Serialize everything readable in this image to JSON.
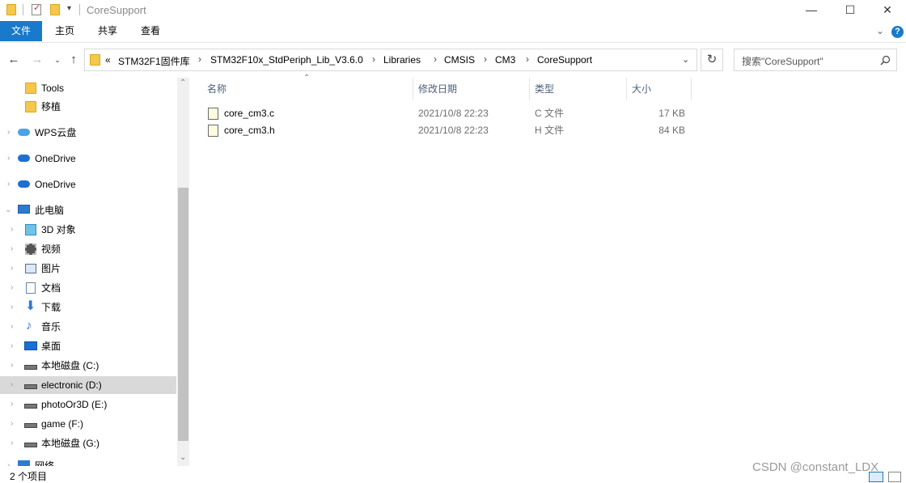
{
  "window": {
    "title": "CoreSupport",
    "minimize": "—",
    "maximize": "☐",
    "close": "✕"
  },
  "ribbon": {
    "tabs": [
      "文件",
      "主页",
      "共享",
      "查看"
    ]
  },
  "address": {
    "overflow": "«",
    "crumbs": [
      "STM32F1固件库",
      "STM32F10x_StdPeriph_Lib_V3.6.0",
      "Libraries",
      "CMSIS",
      "CM3",
      "CoreSupport"
    ]
  },
  "search": {
    "placeholder": "搜索\"CoreSupport\""
  },
  "nav": {
    "items": [
      {
        "label": "Tools",
        "icon": "folder-icon"
      },
      {
        "label": "移植",
        "icon": "folder-icon"
      },
      {
        "label": "WPS云盘",
        "icon": "cloud-icon"
      },
      {
        "label": "OneDrive",
        "icon": "cloud-icon"
      },
      {
        "label": "OneDrive",
        "icon": "cloud-icon"
      },
      {
        "label": "此电脑",
        "icon": "pc-icon"
      },
      {
        "label": "3D 对象",
        "icon": "cube-icon"
      },
      {
        "label": "视频",
        "icon": "video-icon"
      },
      {
        "label": "图片",
        "icon": "picture-icon"
      },
      {
        "label": "文档",
        "icon": "document-icon"
      },
      {
        "label": "下载",
        "icon": "download-icon"
      },
      {
        "label": "音乐",
        "icon": "music-icon"
      },
      {
        "label": "桌面",
        "icon": "desktop-icon"
      },
      {
        "label": "本地磁盘 (C:)",
        "icon": "drive-icon"
      },
      {
        "label": "electronic (D:)",
        "icon": "drive-icon"
      },
      {
        "label": "photoOr3D (E:)",
        "icon": "drive-icon"
      },
      {
        "label": "game (F:)",
        "icon": "drive-icon"
      },
      {
        "label": "本地磁盘 (G:)",
        "icon": "drive-icon"
      },
      {
        "label": "网络",
        "icon": "network-icon"
      }
    ]
  },
  "list": {
    "columns": [
      "名称",
      "修改日期",
      "类型",
      "大小"
    ],
    "rows": [
      {
        "name": "core_cm3.c",
        "date": "2021/10/8 22:23",
        "type": "C 文件",
        "size": "17 KB"
      },
      {
        "name": "core_cm3.h",
        "date": "2021/10/8 22:23",
        "type": "H 文件",
        "size": "84 KB"
      }
    ]
  },
  "status": {
    "count": "2 个项目"
  },
  "watermark": "CSDN @constant_LDX",
  "colors": {
    "accent": "#1979ca",
    "selected": "#d9d9d9",
    "folder": "#f5c84c"
  }
}
